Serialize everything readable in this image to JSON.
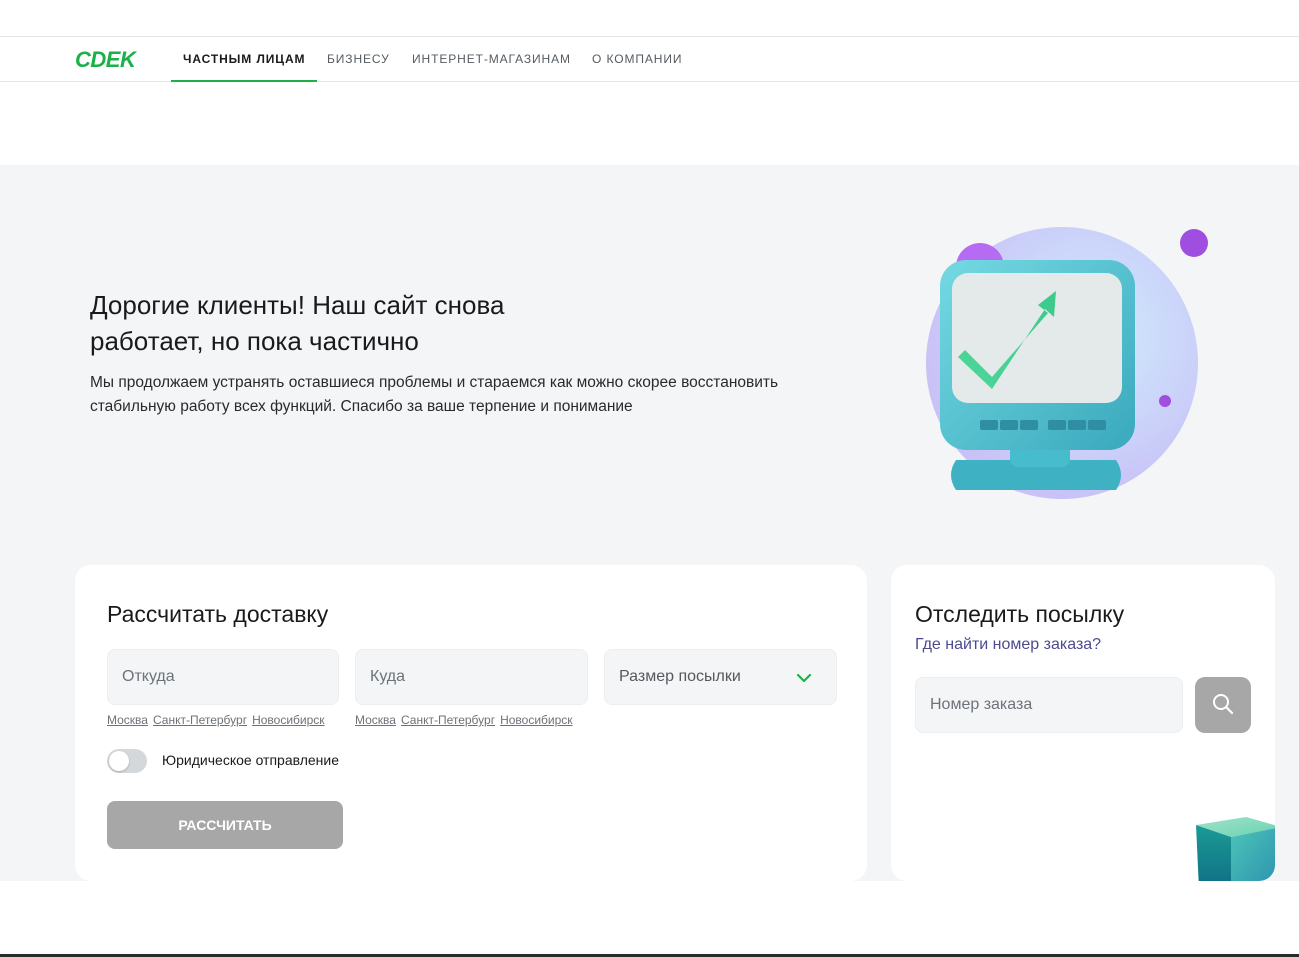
{
  "brand": {
    "logo_text": "CDEK",
    "accent_color": "#1ab248"
  },
  "nav": {
    "items": [
      {
        "label": "ЧАСТНЫМ ЛИЦАМ",
        "active": true
      },
      {
        "label": "БИЗНЕСУ",
        "active": false
      },
      {
        "label": "ИНТЕРНЕТ-МАГАЗИНАМ",
        "active": false
      },
      {
        "label": "О КОМПАНИИ",
        "active": false
      }
    ]
  },
  "hero": {
    "title": "Дорогие клиенты! Наш сайт снова работает, но пока частично",
    "text": "Мы продолжаем устранять оставшиеся проблемы и стараемся как можно скорее восстановить стабильную работу всех функций. Спасибо за ваше терпение и понимание",
    "illustration_icon": "monitor-checkmark-icon"
  },
  "calculator": {
    "title": "Рассчитать доставку",
    "from_placeholder": "Откуда",
    "to_placeholder": "Куда",
    "size_label": "Размер посылки",
    "from_cities": [
      "Москва",
      "Санкт-Петербург",
      "Новосибирск"
    ],
    "to_cities": [
      "Москва",
      "Санкт-Петербург",
      "Новосибирск"
    ],
    "legal_toggle_label": "Юридическое отправление",
    "legal_toggle_on": false,
    "submit_label": "РАССЧИТАТЬ"
  },
  "tracking": {
    "title": "Отследить посылку",
    "help_link": "Где найти номер заказа?",
    "order_placeholder": "Номер заказа",
    "search_icon": "search-icon"
  }
}
